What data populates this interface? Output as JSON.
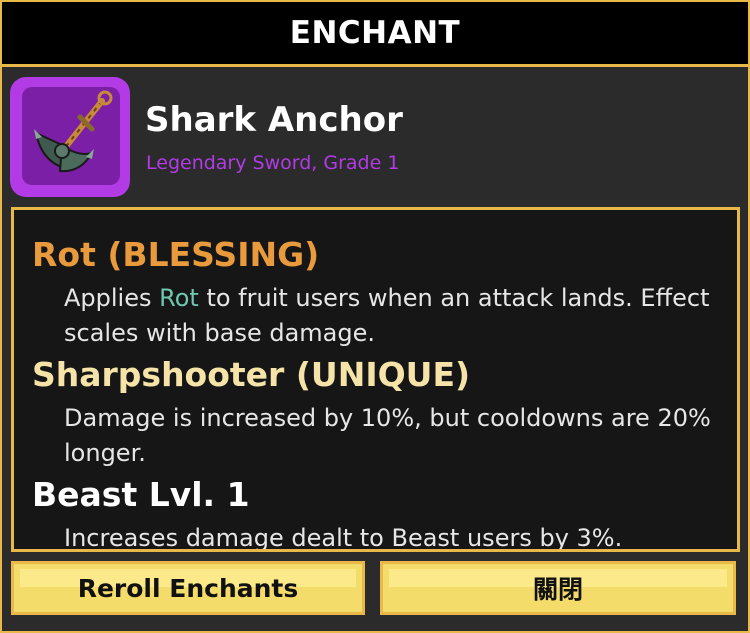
{
  "window": {
    "title": "ENCHANT"
  },
  "item": {
    "name": "Shark Anchor",
    "subtitle": "Legendary Sword, Grade 1",
    "icon": "anchor-sword-icon",
    "rarity_color": "#b23be6"
  },
  "enchants": [
    {
      "title": "Rot (BLESSING)",
      "color": "#e89a3c",
      "desc_before": "Applies ",
      "desc_highlight": "Rot",
      "desc_after": " to fruit users when an attack lands. Effect scales with base damage."
    },
    {
      "title": "Sharpshooter (UNIQUE)",
      "color": "#f5e3a8",
      "description": "Damage is increased by 10%, but cooldowns are 20% longer."
    },
    {
      "title": "Beast Lvl. 1",
      "color": "#ffffff",
      "description": "Increases damage dealt to Beast users by 3%."
    }
  ],
  "buttons": {
    "reroll": "Reroll Enchants",
    "close": "關閉"
  },
  "colors": {
    "accent": "#e8b948",
    "button": "#f4dc6a",
    "highlight": "#6fc7b0"
  }
}
